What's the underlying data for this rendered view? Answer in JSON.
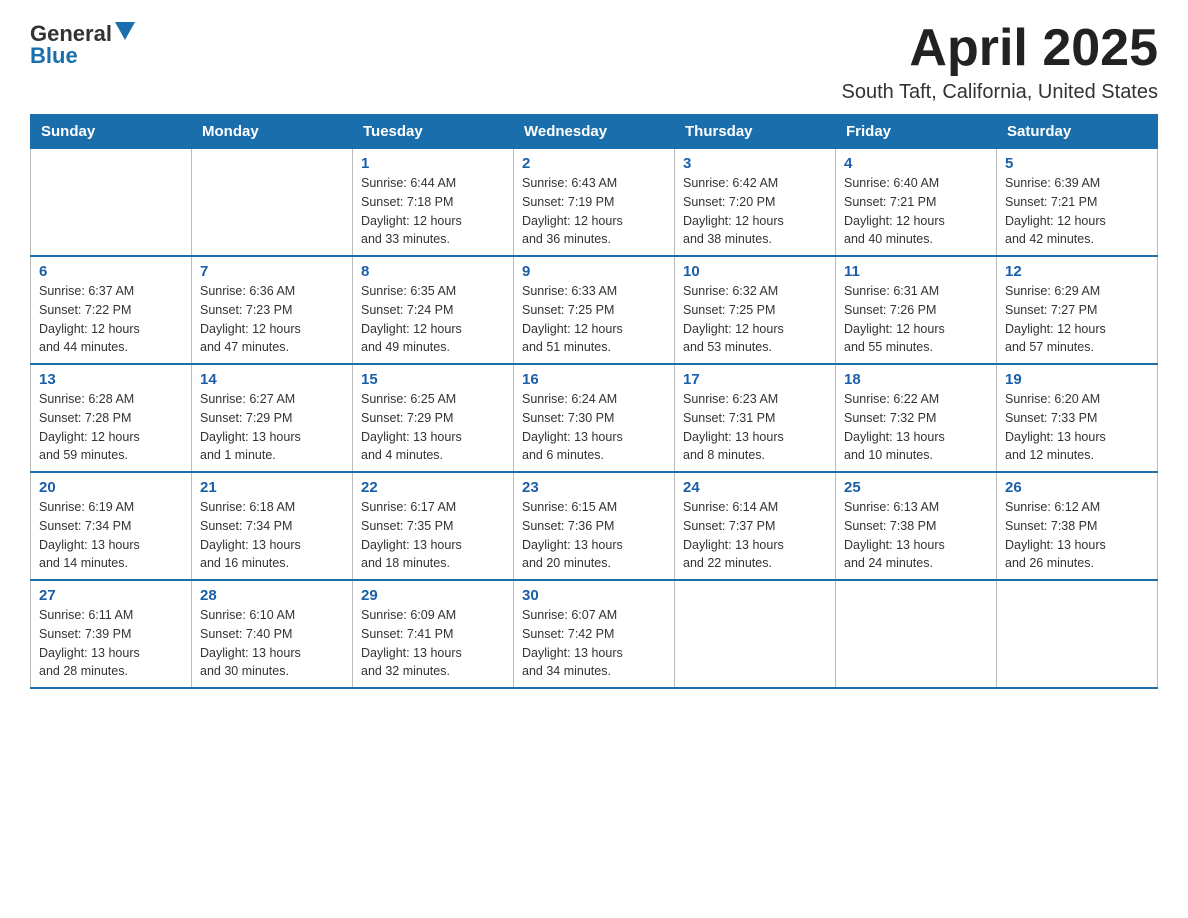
{
  "header": {
    "logo_text_general": "General",
    "logo_text_blue": "Blue",
    "title": "April 2025",
    "subtitle": "South Taft, California, United States"
  },
  "days_of_week": [
    "Sunday",
    "Monday",
    "Tuesday",
    "Wednesday",
    "Thursday",
    "Friday",
    "Saturday"
  ],
  "weeks": [
    [
      {
        "day": "",
        "info": ""
      },
      {
        "day": "",
        "info": ""
      },
      {
        "day": "1",
        "info": "Sunrise: 6:44 AM\nSunset: 7:18 PM\nDaylight: 12 hours\nand 33 minutes."
      },
      {
        "day": "2",
        "info": "Sunrise: 6:43 AM\nSunset: 7:19 PM\nDaylight: 12 hours\nand 36 minutes."
      },
      {
        "day": "3",
        "info": "Sunrise: 6:42 AM\nSunset: 7:20 PM\nDaylight: 12 hours\nand 38 minutes."
      },
      {
        "day": "4",
        "info": "Sunrise: 6:40 AM\nSunset: 7:21 PM\nDaylight: 12 hours\nand 40 minutes."
      },
      {
        "day": "5",
        "info": "Sunrise: 6:39 AM\nSunset: 7:21 PM\nDaylight: 12 hours\nand 42 minutes."
      }
    ],
    [
      {
        "day": "6",
        "info": "Sunrise: 6:37 AM\nSunset: 7:22 PM\nDaylight: 12 hours\nand 44 minutes."
      },
      {
        "day": "7",
        "info": "Sunrise: 6:36 AM\nSunset: 7:23 PM\nDaylight: 12 hours\nand 47 minutes."
      },
      {
        "day": "8",
        "info": "Sunrise: 6:35 AM\nSunset: 7:24 PM\nDaylight: 12 hours\nand 49 minutes."
      },
      {
        "day": "9",
        "info": "Sunrise: 6:33 AM\nSunset: 7:25 PM\nDaylight: 12 hours\nand 51 minutes."
      },
      {
        "day": "10",
        "info": "Sunrise: 6:32 AM\nSunset: 7:25 PM\nDaylight: 12 hours\nand 53 minutes."
      },
      {
        "day": "11",
        "info": "Sunrise: 6:31 AM\nSunset: 7:26 PM\nDaylight: 12 hours\nand 55 minutes."
      },
      {
        "day": "12",
        "info": "Sunrise: 6:29 AM\nSunset: 7:27 PM\nDaylight: 12 hours\nand 57 minutes."
      }
    ],
    [
      {
        "day": "13",
        "info": "Sunrise: 6:28 AM\nSunset: 7:28 PM\nDaylight: 12 hours\nand 59 minutes."
      },
      {
        "day": "14",
        "info": "Sunrise: 6:27 AM\nSunset: 7:29 PM\nDaylight: 13 hours\nand 1 minute."
      },
      {
        "day": "15",
        "info": "Sunrise: 6:25 AM\nSunset: 7:29 PM\nDaylight: 13 hours\nand 4 minutes."
      },
      {
        "day": "16",
        "info": "Sunrise: 6:24 AM\nSunset: 7:30 PM\nDaylight: 13 hours\nand 6 minutes."
      },
      {
        "day": "17",
        "info": "Sunrise: 6:23 AM\nSunset: 7:31 PM\nDaylight: 13 hours\nand 8 minutes."
      },
      {
        "day": "18",
        "info": "Sunrise: 6:22 AM\nSunset: 7:32 PM\nDaylight: 13 hours\nand 10 minutes."
      },
      {
        "day": "19",
        "info": "Sunrise: 6:20 AM\nSunset: 7:33 PM\nDaylight: 13 hours\nand 12 minutes."
      }
    ],
    [
      {
        "day": "20",
        "info": "Sunrise: 6:19 AM\nSunset: 7:34 PM\nDaylight: 13 hours\nand 14 minutes."
      },
      {
        "day": "21",
        "info": "Sunrise: 6:18 AM\nSunset: 7:34 PM\nDaylight: 13 hours\nand 16 minutes."
      },
      {
        "day": "22",
        "info": "Sunrise: 6:17 AM\nSunset: 7:35 PM\nDaylight: 13 hours\nand 18 minutes."
      },
      {
        "day": "23",
        "info": "Sunrise: 6:15 AM\nSunset: 7:36 PM\nDaylight: 13 hours\nand 20 minutes."
      },
      {
        "day": "24",
        "info": "Sunrise: 6:14 AM\nSunset: 7:37 PM\nDaylight: 13 hours\nand 22 minutes."
      },
      {
        "day": "25",
        "info": "Sunrise: 6:13 AM\nSunset: 7:38 PM\nDaylight: 13 hours\nand 24 minutes."
      },
      {
        "day": "26",
        "info": "Sunrise: 6:12 AM\nSunset: 7:38 PM\nDaylight: 13 hours\nand 26 minutes."
      }
    ],
    [
      {
        "day": "27",
        "info": "Sunrise: 6:11 AM\nSunset: 7:39 PM\nDaylight: 13 hours\nand 28 minutes."
      },
      {
        "day": "28",
        "info": "Sunrise: 6:10 AM\nSunset: 7:40 PM\nDaylight: 13 hours\nand 30 minutes."
      },
      {
        "day": "29",
        "info": "Sunrise: 6:09 AM\nSunset: 7:41 PM\nDaylight: 13 hours\nand 32 minutes."
      },
      {
        "day": "30",
        "info": "Sunrise: 6:07 AM\nSunset: 7:42 PM\nDaylight: 13 hours\nand 34 minutes."
      },
      {
        "day": "",
        "info": ""
      },
      {
        "day": "",
        "info": ""
      },
      {
        "day": "",
        "info": ""
      }
    ]
  ]
}
